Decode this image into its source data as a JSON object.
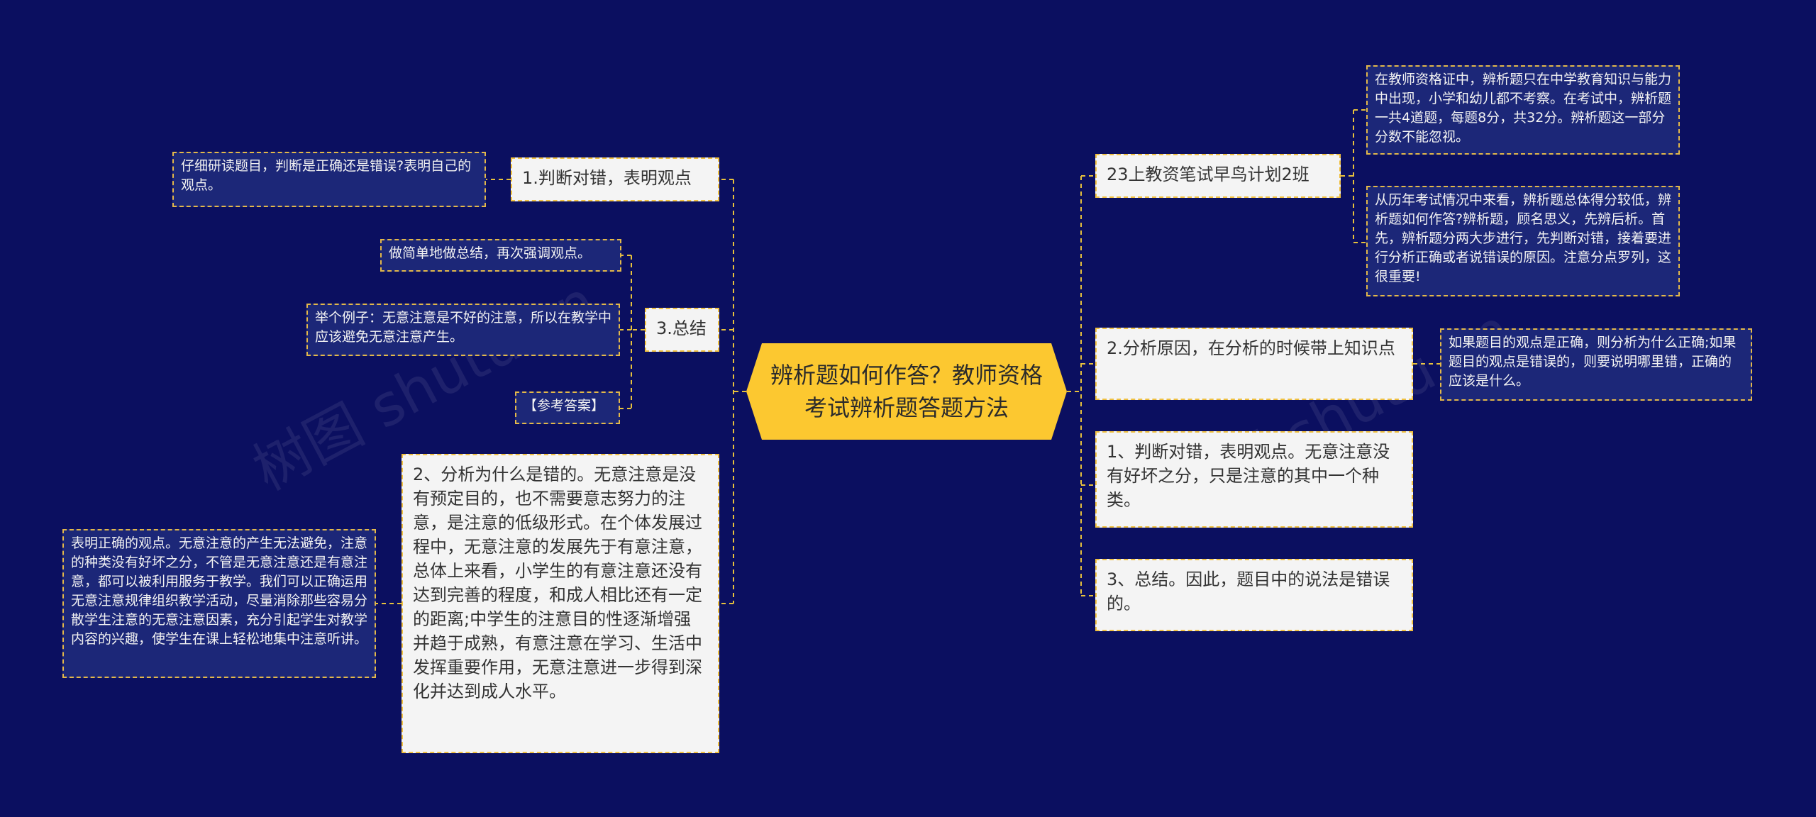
{
  "root": {
    "title": "辨析题如何作答？教师资格考试辨析题答题方法"
  },
  "left": {
    "n1": {
      "label": "1.判断对错，表明观点",
      "note": "仔细研读题目，判断是正确还是错误?表明自己的观点。"
    },
    "n3": {
      "label": "3.总结",
      "notes": [
        "做简单地做总结，再次强调观点。",
        "举个例子：无意注意是不好的注意，所以在教学中应该避免无意注意产生。",
        "【参考答案】"
      ]
    },
    "n2": {
      "label": "2、分析为什么是错的。无意注意是没有预定目的，也不需要意志努力的注意，是注意的低级形式。在个体发展过程中，无意注意的发展先于有意注意，总体上来看，小学生的有意注意还没有达到完善的程度，和成人相比还有一定的距离;中学生的注意目的性逐渐增强并趋于成熟，有意注意在学习、生活中发挥重要作用，无意注意进一步得到深化并达到成人水平。",
      "note": "表明正确的观点。无意注意的产生无法避免，注意的种类没有好坏之分，不管是无意注意还是有意注意，都可以被利用服务于教学。我们可以正确运用无意注意规律组织教学活动，尽量消除那些容易分散学生注意的无意注意因素，充分引起学生对教学内容的兴趣，使学生在课上轻松地集中注意听讲。"
    }
  },
  "right": {
    "r1": {
      "label": "23上教资笔试早鸟计划2班",
      "notes": [
        "在教师资格证中，辨析题只在中学教育知识与能力中出现，小学和幼儿都不考察。在考试中，辨析题一共4道题，每题8分，共32分。辨析题这一部分分数不能忽视。",
        "从历年考试情况中来看，辨析题总体得分较低，辨析题如何作答?辨析题，顾名思义，先辨后析。首先，辨析题分两大步进行，先判断对错，接着要进行分析正确或者说错误的原因。注意分点罗列，这很重要!"
      ]
    },
    "r2": {
      "label": "2.分析原因，在分析的时候带上知识点",
      "note": "如果题目的观点是正确，则分析为什么正确;如果题目的观点是错误的，则要说明哪里错，正确的应该是什么。"
    },
    "r3": {
      "label": "1、判断对错，表明观点。无意注意没有好坏之分，只是注意的其中一个种类。"
    },
    "r4": {
      "label": "3、总结。因此，题目中的说法是错误的。"
    }
  },
  "watermarks": [
    "树图 shutu.cn",
    "树图 shutu.cn"
  ],
  "colors": {
    "background": "#0b0f60",
    "root": "#fcc830",
    "connector": "#e7c13c",
    "leaf_bg": "#1c2778",
    "node_bg": "#f4f4f4"
  }
}
